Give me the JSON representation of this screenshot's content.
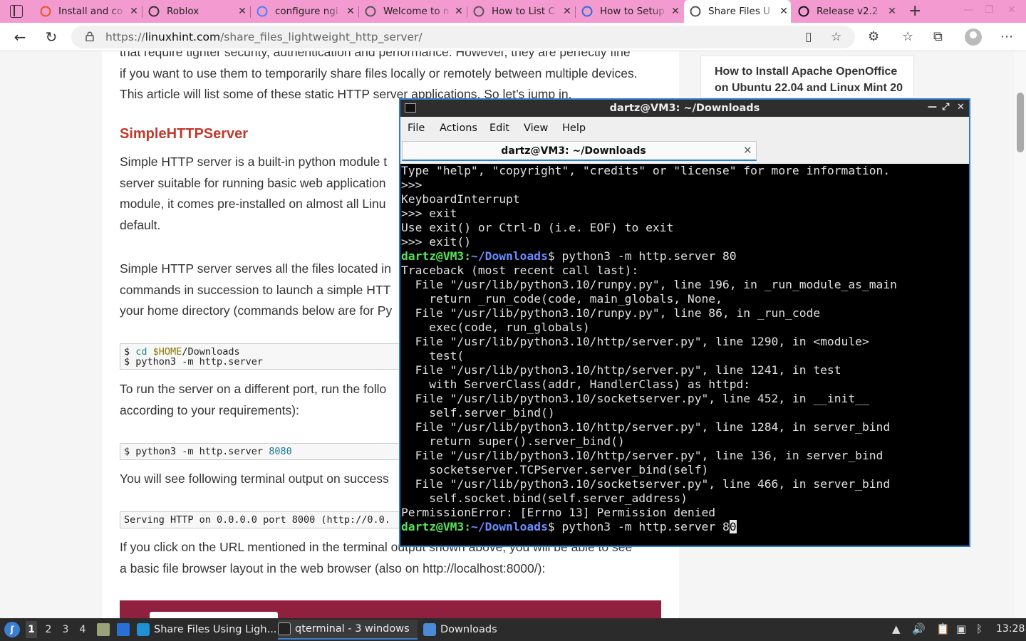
{
  "browser": {
    "tabs": [
      {
        "title": "Install and co",
        "icon": "ubuntu-icon",
        "color": "#e95420"
      },
      {
        "title": "Roblox",
        "icon": "roblox-icon",
        "color": "#333333"
      },
      {
        "title": "configure ngi",
        "icon": "google-icon",
        "color": "#4285f4"
      },
      {
        "title": "Welcome to n",
        "icon": "page-icon",
        "color": "#555555"
      },
      {
        "title": "How to List C",
        "icon": "linuxhint-icon",
        "color": "#555555"
      },
      {
        "title": "How to Setup",
        "icon": "bluebird-icon",
        "color": "#2a6fd6"
      },
      {
        "title": "Share Files U",
        "icon": "linuxhint-icon",
        "color": "#555555"
      },
      {
        "title": "Release v2.2",
        "icon": "github-icon",
        "color": "#111111"
      }
    ],
    "active_tab_index": 6,
    "url_prefix": "https://",
    "url_domain": "linuxhint.com",
    "url_path": "/share_files_lightweight_http_server/"
  },
  "article": {
    "intro_lines": [
      "that require tighter security, authentication and performance. However, they are perfectly fine",
      "if you want to use them to temporarily share files locally or remotely between multiple devices.",
      "This article will list some of these static HTTP server applications. So let’s jump in."
    ],
    "heading": "SimpleHTTPServer",
    "para1": [
      "Simple HTTP server is a built-in python module t",
      "server suitable for running basic web application",
      "module, it comes pre-installed on almost all Linu",
      "default."
    ],
    "para2": [
      "Simple HTTP server serves all the files located in",
      "commands in succession to launch a simple HTT",
      "your home directory (commands below are for Py"
    ],
    "code1": {
      "line1_prefix": "$ ",
      "line1_cmd": "cd",
      "line1_var": "$HOME",
      "line1_rest": "/Downloads",
      "line2": "$ python3 -m http.server"
    },
    "para3": [
      "To run the server on a different port, run the follo",
      "according to your requirements):"
    ],
    "code2": {
      "prefix": "$ python3 -m http.server ",
      "port": "8080"
    },
    "para4": "You will see following terminal output on success",
    "code3": "Serving HTTP on 0.0.0.0 port 8000 (http://0.0.",
    "para5": [
      "If you click on the URL mentioned in the terminal output shown above, you will be able to see",
      "a basic file browser layout in the web browser (also on http://localhost:8000/):"
    ]
  },
  "sidebar": {
    "card_title": "How to Install Apache OpenOffice on Ubuntu 22.04 and Linux Mint 20"
  },
  "terminal": {
    "window_title": "dartz@VM3: ~/Downloads",
    "menu": [
      "File",
      "Actions",
      "Edit",
      "View",
      "Help"
    ],
    "tab_title": "dartz@VM3: ~/Downloads",
    "prompt_user": "dartz@VM3",
    "prompt_sep": ":",
    "prompt_path": "~/Downloads",
    "prompt_dollar": "$",
    "lines": [
      {
        "text": "Type \"help\", \"copyright\", \"credits\" or \"license\" for more information."
      },
      {
        "text": ">>>"
      },
      {
        "text": "KeyboardInterrupt"
      },
      {
        "text": ">>> exit"
      },
      {
        "text": "Use exit() or Ctrl-D (i.e. EOF) to exit"
      },
      {
        "text": ">>> exit()"
      },
      {
        "prompt": true,
        "text": " python3 -m http.server 80"
      },
      {
        "text": "Traceback (most recent call last):"
      },
      {
        "text": "  File \"/usr/lib/python3.10/runpy.py\", line 196, in _run_module_as_main"
      },
      {
        "text": "    return _run_code(code, main_globals, None,"
      },
      {
        "text": "  File \"/usr/lib/python3.10/runpy.py\", line 86, in _run_code"
      },
      {
        "text": "    exec(code, run_globals)"
      },
      {
        "text": "  File \"/usr/lib/python3.10/http/server.py\", line 1290, in <module>"
      },
      {
        "text": "    test("
      },
      {
        "text": "  File \"/usr/lib/python3.10/http/server.py\", line 1241, in test"
      },
      {
        "text": "    with ServerClass(addr, HandlerClass) as httpd:"
      },
      {
        "text": "  File \"/usr/lib/python3.10/socketserver.py\", line 452, in __init__"
      },
      {
        "text": "    self.server_bind()"
      },
      {
        "text": "  File \"/usr/lib/python3.10/http/server.py\", line 1284, in server_bind"
      },
      {
        "text": "    return super().server_bind()"
      },
      {
        "text": "  File \"/usr/lib/python3.10/http/server.py\", line 136, in server_bind"
      },
      {
        "text": "    socketserver.TCPServer.server_bind(self)"
      },
      {
        "text": "  File \"/usr/lib/python3.10/socketserver.py\", line 466, in server_bind"
      },
      {
        "text": "    self.socket.bind(self.server_address)"
      },
      {
        "text": "PermissionError: [Errno 13] Permission denied"
      }
    ],
    "current_input": " python3 -m http.server 8",
    "cursor_char": "0"
  },
  "taskbar": {
    "workspaces": [
      "1",
      "2",
      "3",
      "4"
    ],
    "active_workspace": "1",
    "tasks": [
      {
        "label": "Share Files Using Ligh...",
        "icon": "edge-icon"
      },
      {
        "label": "qterminal - 3 windows",
        "icon": "terminal-icon"
      },
      {
        "label": "Downloads",
        "icon": "folder-icon"
      }
    ],
    "clock": "13:28"
  }
}
